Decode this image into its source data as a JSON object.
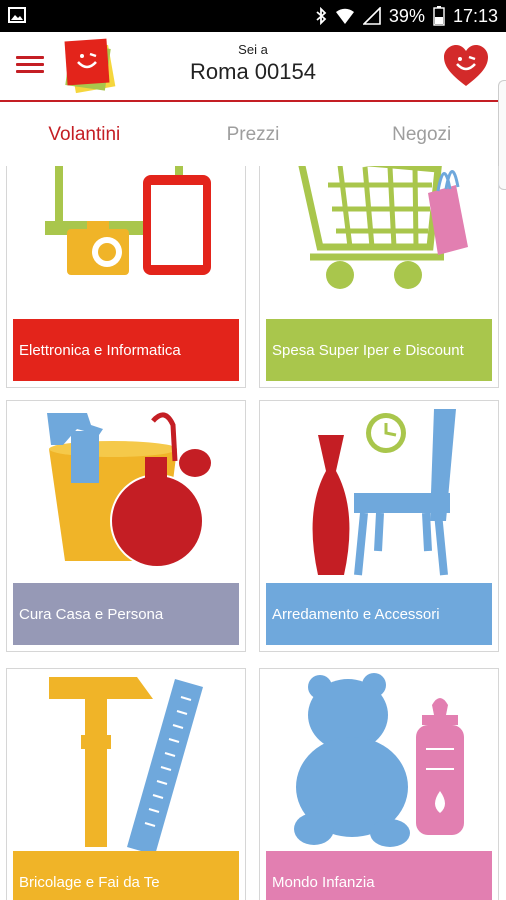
{
  "status_bar": {
    "battery": "39%",
    "time": "17:13"
  },
  "header": {
    "location_prefix": "Sei a",
    "location_city": "Roma 00154"
  },
  "tabs": [
    {
      "label": "Volantini",
      "active": true
    },
    {
      "label": "Prezzi",
      "active": false
    },
    {
      "label": "Negozi",
      "active": false
    }
  ],
  "categories": [
    {
      "label": "Elettronica e Informatica",
      "color": "#e3241b",
      "icon": "laptop-camera-tablet-icon"
    },
    {
      "label": "Spesa Super Iper e Discount",
      "color": "#a9c64c",
      "icon": "shopping-cart-icon"
    },
    {
      "label": "Cura Casa e Persona",
      "color": "#9699b6",
      "icon": "cleaning-perfume-icon"
    },
    {
      "label": "Arredamento e Accessori",
      "color": "#6fa8dc",
      "icon": "chair-vase-clock-icon"
    },
    {
      "label": "Bricolage e Fai da Te",
      "color": "#f0b428",
      "icon": "hammer-ruler-icon"
    },
    {
      "label": "Mondo Infanzia",
      "color": "#e27fb1",
      "icon": "teddy-bottle-icon"
    }
  ],
  "colors": {
    "brand_red": "#c41e24",
    "tab_inactive": "#9e9e9e"
  }
}
